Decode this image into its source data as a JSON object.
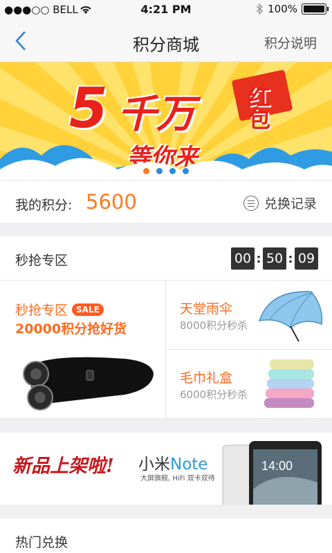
{
  "status_bar": {
    "carrier": "●●●○○ BELL",
    "time": "4:21 PM",
    "battery": "100%",
    "battery_level": 1.0,
    "wifi_icon": "wifi-icon",
    "bluetooth_icon": "bluetooth-icon"
  },
  "nav": {
    "title": "积分商城",
    "right_link": "积分说明",
    "back_icon": "chevron-left-icon"
  },
  "banner": {
    "big_number": "5",
    "line1": "千万",
    "badge_text": "红包",
    "line2": "等你来",
    "page_count": 4,
    "active_index": 0
  },
  "points": {
    "label": "我的积分:",
    "value": "5600",
    "record_label": "兑换记录",
    "record_icon": "list-icon"
  },
  "flash_sale": {
    "title": "秒抢专区",
    "timer": {
      "hours": "00",
      "minutes": "50",
      "seconds": "09"
    },
    "main": {
      "title": "秒抢专区",
      "badge": "SALE",
      "headline": "20000积分抢好货",
      "image": "electric-shaver"
    },
    "items": [
      {
        "name": "天堂雨伞",
        "sub": "8000积分秒杀",
        "image": "umbrella"
      },
      {
        "name": "毛巾礼盒",
        "sub": "6000积分秒杀",
        "image": "towel-stack"
      }
    ]
  },
  "new_banner": {
    "slogan": "新品上架啦!",
    "product_prefix": "小米",
    "product_name": "Note",
    "spec": "大屏旗舰, HiFi 双卡双待",
    "phone_time": "14:00"
  },
  "hot": {
    "title": "热门兑换"
  },
  "colors": {
    "accent": "#ff7a1e",
    "sale_red": "#ff5a1e",
    "banner_red": "#e8211b",
    "nav_blue": "#2a8cdc"
  }
}
